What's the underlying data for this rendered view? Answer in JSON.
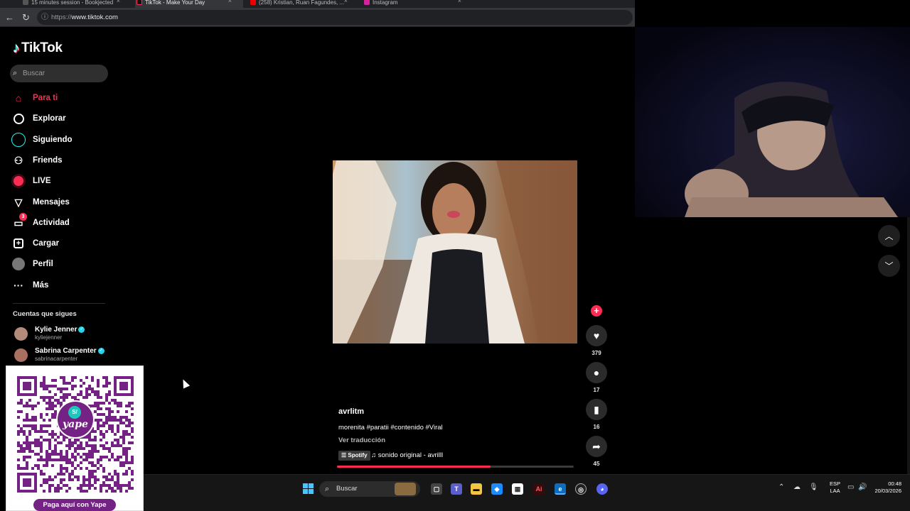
{
  "browser": {
    "tabs": [
      {
        "label": "15 minutes session - Bookjected",
        "active": false
      },
      {
        "label": "TikTok - Make Your Day",
        "active": true
      },
      {
        "label": "(258) Kristian, Ruan Fagundes, ...",
        "active": false
      },
      {
        "label": "Instagram",
        "active": false
      }
    ],
    "url_protocol": "https://",
    "url_host": "www.tiktok.com"
  },
  "tiktok": {
    "logo": "TikTok",
    "search_placeholder": "Buscar",
    "nav": [
      {
        "label": "Para ti",
        "icon": "home-icon",
        "active": true
      },
      {
        "label": "Explorar",
        "icon": "compass-icon",
        "active": false
      },
      {
        "label": "Siguiendo",
        "icon": "following-circle-icon",
        "active": false
      },
      {
        "label": "Friends",
        "icon": "friends-icon",
        "active": false
      },
      {
        "label": "LIVE",
        "icon": "live-icon",
        "active": false
      },
      {
        "label": "Mensajes",
        "icon": "messages-icon",
        "active": false
      },
      {
        "label": "Actividad",
        "icon": "activity-icon",
        "active": false,
        "badge": "3"
      },
      {
        "label": "Cargar",
        "icon": "upload-icon",
        "active": false
      },
      {
        "label": "Perfil",
        "icon": "profile-avatar-icon",
        "active": false
      },
      {
        "label": "Más",
        "icon": "more-icon",
        "active": false
      }
    ],
    "following_heading": "Cuentas que sigues",
    "following": [
      {
        "name": "Kylie Jenner",
        "handle": "kyliejenner",
        "verified": true
      },
      {
        "name": "Sabrina Carpenter",
        "handle": "sabrinacarpenter",
        "verified": true
      }
    ],
    "video": {
      "creator": "avrlitm",
      "caption": "morenita #paratii #contenido #Viral",
      "translate": "Ver traducción",
      "spotify": "Spotify",
      "music": "sonido original - avrilll",
      "progress": 0.65
    },
    "actions": {
      "likes": "379",
      "comments": "17",
      "saves": "16",
      "shares": "45"
    }
  },
  "overlay": {
    "qr_brand": "yape",
    "qr_currency": "S/",
    "qr_button": "Paga aquí con Yape"
  },
  "taskbar": {
    "search": "Buscar",
    "lang_line1": "ESP",
    "lang_line2": "LAA",
    "time": "00:48",
    "date": "20/03/2026"
  },
  "colors": {
    "tiktok_red": "#fe2c55",
    "yape_purple": "#742284",
    "background": "#000000"
  }
}
